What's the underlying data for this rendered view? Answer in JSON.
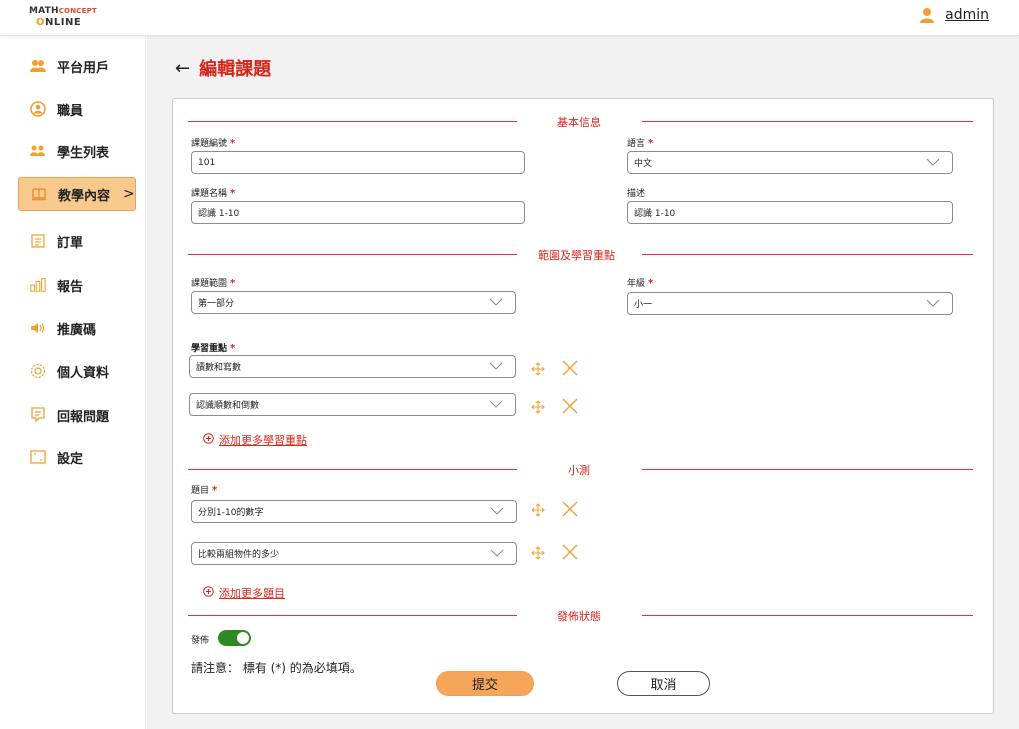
{
  "brand": {
    "logo_line1_a": "Math",
    "logo_line1_b": "Concept",
    "logo_line2_a": "O",
    "logo_line2_b": "NLINE"
  },
  "user": {
    "name": "admin"
  },
  "sidebar": {
    "items": [
      {
        "label": "平台用戶",
        "icon": "users-group-icon"
      },
      {
        "label": "職員",
        "icon": "staff-icon"
      },
      {
        "label": "學生列表",
        "icon": "students-icon"
      },
      {
        "label": "教學內容",
        "icon": "book-icon",
        "chevron": ">"
      },
      {
        "label": "訂單",
        "icon": "order-icon"
      },
      {
        "label": "報告",
        "icon": "report-icon"
      },
      {
        "label": "推廣碼",
        "icon": "speaker-icon"
      },
      {
        "label": "個人資料",
        "icon": "settings-gear-icon"
      },
      {
        "label": "回報問題",
        "icon": "feedback-icon"
      },
      {
        "label": "設定",
        "icon": "settings-icon"
      }
    ]
  },
  "page": {
    "back": "←",
    "title": "編輯課題"
  },
  "sections": {
    "basic": "基本信息",
    "scope": "範圍及學習重點",
    "quiz": "小測",
    "publish": "發佈狀態"
  },
  "form": {
    "topic_code": {
      "label": "課題編號",
      "value": "101"
    },
    "language": {
      "label": "語言",
      "value": "中文"
    },
    "topic_name": {
      "label": "課題名稱",
      "value": "認識 1-10"
    },
    "description": {
      "label": "描述",
      "value": "認識 1-10"
    },
    "topic_scope": {
      "label": "課題範圍",
      "value": "第一部分"
    },
    "grade": {
      "label": "年級",
      "value": "小一"
    },
    "focus": {
      "label": "學習重點",
      "items": [
        "讀數和寫數",
        "認識順數和倒數"
      ],
      "add": "添加更多學習重點"
    },
    "questions": {
      "label": "題目",
      "items": [
        "分別1-10的數字",
        "比較兩組物件的多少"
      ],
      "add": "添加更多題目"
    },
    "publish": {
      "label": "發佈",
      "on": true
    }
  },
  "note": "請注意： 標有 (*) 的為必填項。",
  "buttons": {
    "submit": "提交",
    "cancel": "取消"
  },
  "required_mark": "*",
  "colors": {
    "accent_red": "#d9261c",
    "accent_orange": "#f5a65b",
    "toggle_green": "#2f8a26"
  }
}
